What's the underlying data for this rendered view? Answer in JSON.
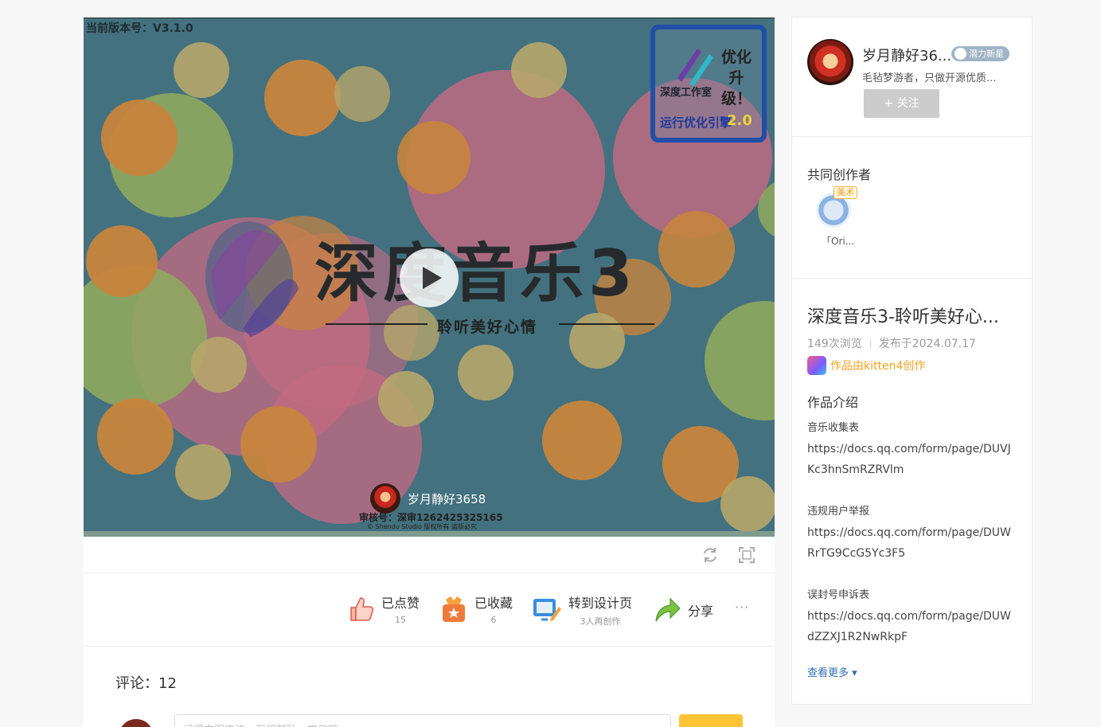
{
  "player": {
    "version_label": "当前版本号：V3.1.0",
    "logo_line1": "优化升级！",
    "logo_studio": "深度工作室",
    "logo_engine": "运行优化引擎",
    "logo_version": "2.0",
    "main_title": "深度音乐3",
    "subtitle": "聆听美好心情",
    "author_name": "岁月静好3658",
    "audit_text": "审核号：深审1262425325165",
    "copyright_text": "© Shendu Studio 版权所有 盗版必究"
  },
  "actions": {
    "liked_label": "已点赞",
    "liked_count": "15",
    "collected_label": "已收藏",
    "collected_count": "6",
    "remix_label": "转到设计页",
    "remix_sub": "3人再创作",
    "share_label": "分享",
    "more_label": "···"
  },
  "comments": {
    "count_label": "评论：12",
    "placeholder": "记得文明交流，互相帮助，学习哦"
  },
  "author": {
    "name": "岁月静好36...",
    "badge": "潜力新星",
    "bio": "毛毡梦游者，只做开源优质...",
    "follow_label": "+ 关注"
  },
  "cocreators": {
    "title": "共同创作者",
    "tag": "美术",
    "name": "「Ori..."
  },
  "work": {
    "title": "深度音乐3-聆听美好心...",
    "views": "149次浏览",
    "published": "发布于2024.07.17",
    "made_with": "作品由kitten4创作",
    "intro_title": "作品介绍",
    "desc": [
      {
        "heading": "音乐收集表",
        "link": "https://docs.qq.com/form/page/DUVJKc3hnSmRZRVlm"
      },
      {
        "heading": "违规用户举报",
        "link": "https://docs.qq.com/form/page/DUWRrTG9CcG5Yc3F5"
      },
      {
        "heading": "误封号申诉表",
        "link": "https://docs.qq.com/form/page/DUWdZZXJ1R2NwRkpF"
      }
    ],
    "see_more": "查看更多 ▾"
  },
  "colors": {
    "accent_orange": "#f3a21b",
    "submit_yellow": "#fec433",
    "link_blue": "#2f6fb5",
    "player_bg": "#43717f"
  }
}
